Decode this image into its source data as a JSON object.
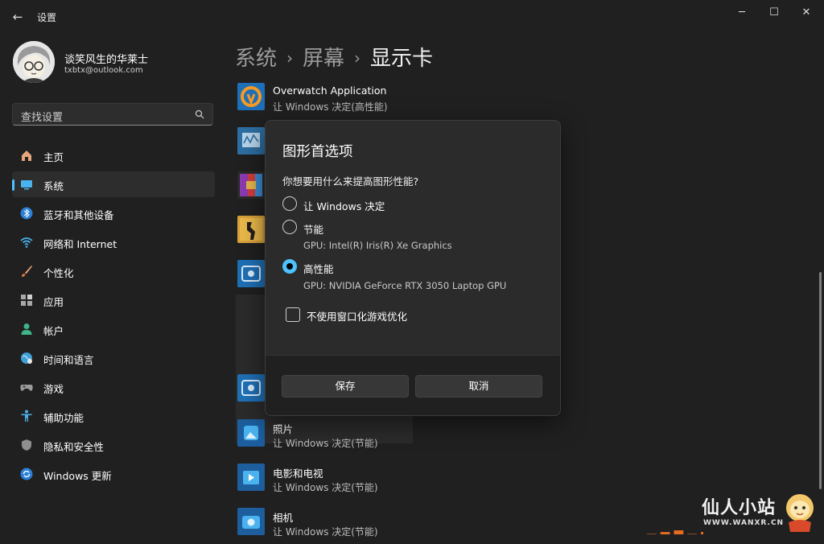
{
  "window": {
    "title": "设置",
    "controls": {
      "minimize": "─",
      "maximize": "☐",
      "close": "✕"
    }
  },
  "profile": {
    "name": "谈笑风生的华莱士",
    "email": "txbtx@outlook.com"
  },
  "search": {
    "placeholder": "查找设置",
    "icon": "search-icon"
  },
  "sidebar": {
    "items": [
      {
        "label": "主页",
        "icon": "home-icon",
        "active": false
      },
      {
        "label": "系统",
        "icon": "system-icon",
        "active": true
      },
      {
        "label": "蓝牙和其他设备",
        "icon": "bluetooth-icon",
        "active": false
      },
      {
        "label": "网络和 Internet",
        "icon": "wifi-icon",
        "active": false
      },
      {
        "label": "个性化",
        "icon": "brush-icon",
        "active": false
      },
      {
        "label": "应用",
        "icon": "apps-icon",
        "active": false
      },
      {
        "label": "帐户",
        "icon": "account-icon",
        "active": false
      },
      {
        "label": "时间和语言",
        "icon": "globe-icon",
        "active": false
      },
      {
        "label": "游戏",
        "icon": "gamepad-icon",
        "active": false
      },
      {
        "label": "辅助功能",
        "icon": "accessibility-icon",
        "active": false
      },
      {
        "label": "隐私和安全性",
        "icon": "shield-icon",
        "active": false
      },
      {
        "label": "Windows 更新",
        "icon": "update-icon",
        "active": false
      }
    ]
  },
  "breadcrumb": {
    "parts": [
      "系统",
      "屏幕",
      "显示卡"
    ],
    "separator": "›"
  },
  "app_list": [
    {
      "name": "Overwatch Application",
      "preference": "让 Windows 决定(高性能)",
      "icon": "overwatch-icon"
    },
    {
      "name": "",
      "preference": "",
      "icon": "monitor-app-icon"
    },
    {
      "name": "",
      "preference": "",
      "icon": "winrar-icon"
    },
    {
      "name": "",
      "preference": "",
      "icon": "csgo-icon"
    },
    {
      "name": "",
      "preference": "",
      "icon": "app-icon"
    },
    {
      "name": "",
      "preference": "",
      "icon": "app-icon"
    },
    {
      "name": "照片",
      "preference": "让 Windows 决定(节能)",
      "icon": "photos-icon"
    },
    {
      "name": "电影和电视",
      "preference": "让 Windows 决定(节能)",
      "icon": "movies-icon"
    },
    {
      "name": "相机",
      "preference": "让 Windows 决定(节能)",
      "icon": "camera-icon"
    }
  ],
  "dialog": {
    "title": "图形首选项",
    "question": "你想要用什么来提高图形性能?",
    "options": [
      {
        "label": "让 Windows 决定",
        "gpu": "",
        "selected": false
      },
      {
        "label": "节能",
        "gpu": "GPU: Intel(R) Iris(R) Xe Graphics",
        "selected": false
      },
      {
        "label": "高性能",
        "gpu": "GPU: NVIDIA GeForce RTX 3050 Laptop GPU",
        "selected": true
      }
    ],
    "checkbox": {
      "label": "不使用窗口化游戏优化",
      "checked": false
    },
    "save": "保存",
    "cancel": "取消"
  },
  "watermark": {
    "text": "仙人小站",
    "url": "WWW.WANXR.CN"
  },
  "colors": {
    "accent": "#4cc2ff",
    "background": "#202020",
    "dialog": "#2b2b2b"
  }
}
